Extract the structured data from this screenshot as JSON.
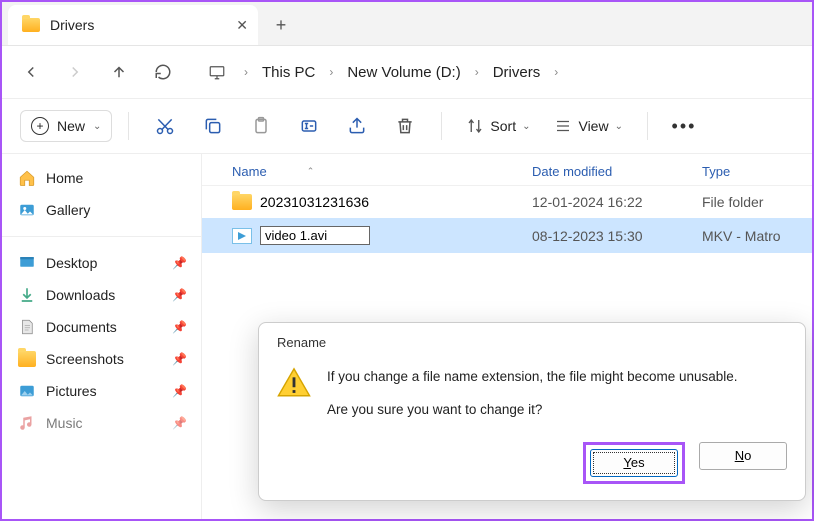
{
  "tab": {
    "title": "Drivers"
  },
  "breadcrumb": [
    "This PC",
    "New Volume (D:)",
    "Drivers"
  ],
  "toolbar": {
    "new_label": "New",
    "sort_label": "Sort",
    "view_label": "View"
  },
  "sidebar": {
    "top": [
      {
        "label": "Home",
        "icon": "home"
      },
      {
        "label": "Gallery",
        "icon": "gallery"
      }
    ],
    "pinned": [
      {
        "label": "Desktop",
        "icon": "desktop"
      },
      {
        "label": "Downloads",
        "icon": "downloads"
      },
      {
        "label": "Documents",
        "icon": "documents"
      },
      {
        "label": "Screenshots",
        "icon": "screenshots"
      },
      {
        "label": "Pictures",
        "icon": "pictures"
      },
      {
        "label": "Music",
        "icon": "music"
      }
    ]
  },
  "columns": {
    "name": "Name",
    "date": "Date modified",
    "type": "Type"
  },
  "rows": [
    {
      "name": "20231031231636",
      "date": "12-01-2024 16:22",
      "type": "File folder",
      "kind": "folder"
    },
    {
      "name": "video 1.avi",
      "date": "08-12-2023 15:30",
      "type": "MKV - Matro",
      "kind": "video",
      "renaming": true
    }
  ],
  "dialog": {
    "title": "Rename",
    "line1": "If you change a file name extension, the file might become unusable.",
    "line2": "Are you sure you want to change it?",
    "yes": "Yes",
    "no": "No"
  }
}
